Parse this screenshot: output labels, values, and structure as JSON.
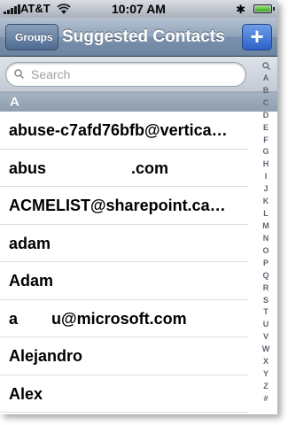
{
  "status_bar": {
    "carrier": "AT&T",
    "time": "10:07 AM"
  },
  "nav": {
    "back_label": "Groups",
    "title": "Suggested Contacts",
    "add_label": "+"
  },
  "search": {
    "placeholder": "Search"
  },
  "section": {
    "letter": "A"
  },
  "contacts": [
    "abuse-c7afd76bfb@vertica…",
    "abus",
    ".com",
    "ACMELIST@sharepoint.ca…",
    "adam",
    "Adam",
    "a",
    "u@microsoft.com",
    "Alejandro",
    "Alex"
  ],
  "index_letters": [
    "A",
    "B",
    "C",
    "D",
    "E",
    "F",
    "G",
    "H",
    "I",
    "J",
    "K",
    "L",
    "M",
    "N",
    "O",
    "P",
    "Q",
    "R",
    "S",
    "T",
    "U",
    "V",
    "W",
    "X",
    "Y",
    "Z",
    "#"
  ]
}
